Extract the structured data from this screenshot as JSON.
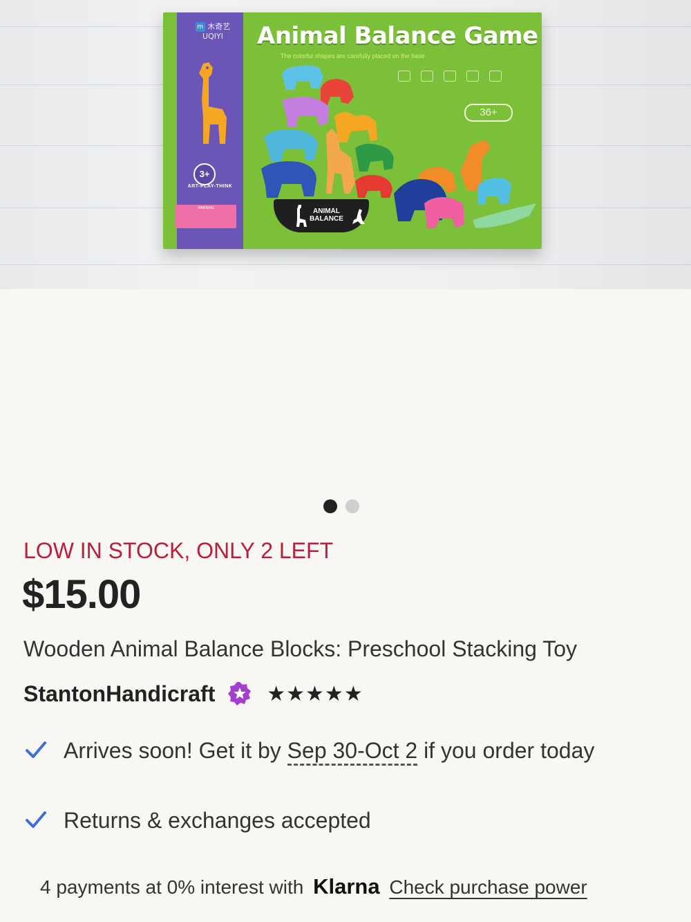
{
  "product_image": {
    "box_brand": "木奇艺 UQIYI",
    "box_title": "Animal Balance Game",
    "box_subtitle": "The colorful shapes are carefully placed on the base",
    "box_age": "3+",
    "box_tagline": "ART-PLAY-THINK",
    "box_warning": "WARNING",
    "box_age_badge": "36+",
    "stand_label_line1": "ANIMAL",
    "stand_label_line2": "BALANCE"
  },
  "carousel": {
    "active_index": 0,
    "count": 2
  },
  "listing": {
    "stock_notice": "LOW IN STOCK, ONLY 2 LEFT",
    "price": "$15.00",
    "title": "Wooden Animal Balance Blocks: Preschool Stacking Toy",
    "seller": "StantonHandicraft",
    "rating_stars": "★★★★★",
    "rating_value": 5
  },
  "benefits": {
    "arrival_prefix": "Arrives soon! Get it by ",
    "arrival_dates": "Sep 30-Oct 2",
    "arrival_suffix": " if you order today",
    "returns": "Returns & exchanges accepted"
  },
  "payment": {
    "text": "4 payments at 0% interest with",
    "provider": "Klarna",
    "link": "Check purchase power"
  },
  "colors": {
    "stock_red": "#b5203c",
    "check_blue": "#3b6ed6",
    "star_seller_purple": "#a23ed0",
    "box_green": "#7cc03a",
    "box_purple": "#6b55b7"
  },
  "icons": [
    "star-seller-icon",
    "check-icon"
  ]
}
